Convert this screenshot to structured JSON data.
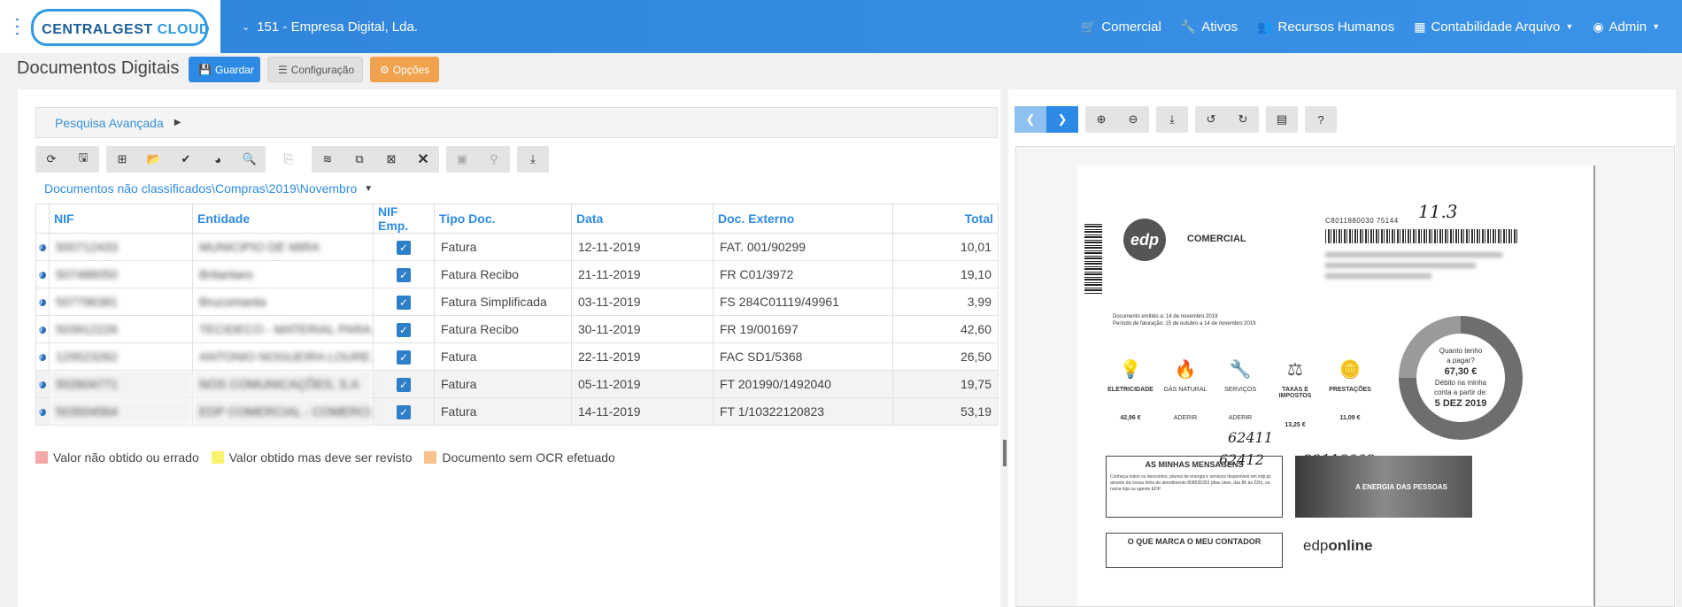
{
  "app": {
    "logo_main": "CENTRALGEST",
    "logo_cloud": "CLOUD",
    "company": "151 - Empresa Digital, Lda.",
    "nav": [
      {
        "label": "Comercial",
        "icon": "cart-icon"
      },
      {
        "label": "Ativos",
        "icon": "wrench-icon"
      },
      {
        "label": "Recursos Humanos",
        "icon": "users-icon"
      },
      {
        "label": "Contabilidade Arquivo",
        "icon": "grid-icon"
      },
      {
        "label": "Admin",
        "icon": "user-circle-icon"
      }
    ]
  },
  "page": {
    "title": "Documentos Digitais",
    "guardar": "Guardar",
    "configuracao": "Configuração",
    "opcoes": "Opções"
  },
  "search": {
    "label": "Pesquisa Avançada"
  },
  "folder": {
    "path": "Documentos não classificados\\Compras\\2019\\Novembro"
  },
  "table": {
    "headers": [
      "NIF",
      "Entidade",
      "NIF Emp.",
      "Tipo Doc.",
      "Data",
      "Doc. Externo",
      "Total"
    ],
    "rows": [
      {
        "nif": "500712433",
        "entidade": "MUNICIPIO DE MIRA",
        "tipo": "Fatura",
        "data": "12-11-2019",
        "doc": "FAT. 001/90299",
        "total": "10,01"
      },
      {
        "nif": "507486050",
        "entidade": "Britantaro",
        "tipo": "Fatura Recibo",
        "data": "21-11-2019",
        "doc": "FR C01/3972",
        "total": "19,10"
      },
      {
        "nif": "507796381",
        "entidade": "Brucomanta",
        "tipo": "Fatura Simplificada",
        "data": "03-11-2019",
        "doc": "FS 284C01119/49961",
        "total": "3,99"
      },
      {
        "nif": "503912226",
        "entidade": "TECIDECO - MATERIAL PARA...",
        "tipo": "Fatura Recibo",
        "data": "30-11-2019",
        "doc": "FR 19/001697",
        "total": "42,60"
      },
      {
        "nif": "129523262",
        "entidade": "ANTONIO NOGUEIRA LOURE...",
        "tipo": "Fatura",
        "data": "22-11-2019",
        "doc": "FAC SD1/5368",
        "total": "26,50"
      },
      {
        "nif": "502604771",
        "entidade": "NOS COMUNICAÇÕES, S.A",
        "tipo": "Fatura",
        "data": "05-11-2019",
        "doc": "FT 201990/1492040",
        "total": "19,75"
      },
      {
        "nif": "503504564",
        "entidade": "EDP COMERCIAL - COMERCI...",
        "tipo": "Fatura",
        "data": "14-11-2019",
        "doc": "FT 1/10322120823",
        "total": "53,19"
      }
    ]
  },
  "legend": [
    {
      "label": "Valor não obtido ou errado",
      "color": "#f4a9a8"
    },
    {
      "label": "Valor obtido mas deve ser revisto",
      "color": "#f7f36b"
    },
    {
      "label": "Documento sem OCR efetuado",
      "color": "#f8c08a"
    }
  ],
  "doc": {
    "hand_top": "11.3",
    "code": "C8011880030 75144",
    "comercial": "COMERCIAL",
    "logo": "edp",
    "emitido": "Documento emitido a: 14 de novembro 2019",
    "periodo": "Período de faturação: 15 de outubro a 14 de novembro 2019",
    "categories": [
      {
        "label": "ELETRICIDADE",
        "value": "42,96 €",
        "icon": "bulb-icon",
        "glyph": "💡"
      },
      {
        "label": "GÁS NATURAL",
        "value": "ADERIR",
        "icon": "flame-icon",
        "glyph": "🔥"
      },
      {
        "label": "SERVIÇOS",
        "value": "ADERIR",
        "icon": "wrench-icon",
        "glyph": "🔧"
      },
      {
        "label": "TAXAS E IMPOSTOS",
        "value": "13,25 €",
        "icon": "scales-icon",
        "glyph": "⚖"
      },
      {
        "label": "PRESTAÇÕES",
        "value": "11,09 €",
        "icon": "coins-icon",
        "glyph": "🪙"
      }
    ],
    "donut": {
      "q1": "Quanto tenho",
      "q2": "a pagar?",
      "amount": "67,30 €",
      "d1": "Débito na minha",
      "d2": "conta a partir de:",
      "date": "5 DEZ 2019"
    },
    "hand_1": "62411",
    "hand_2": "62412",
    "hand_3": "22119002",
    "msg_title": "AS MINHAS MENSAGENS",
    "msg_body": "Conheça todos os descontos, planos de energia e serviços disponíveis em edp.pt, através da nossa linha de atendimento 808535353 (dias úteis, das 8h às 22h), ou numa loja ou agente EDP.",
    "energia": "A ENERGIA DAS PESSOAS",
    "contador": "O QUE MARCA O MEU CONTADOR",
    "edp_a": "edp",
    "edp_b": "online"
  }
}
